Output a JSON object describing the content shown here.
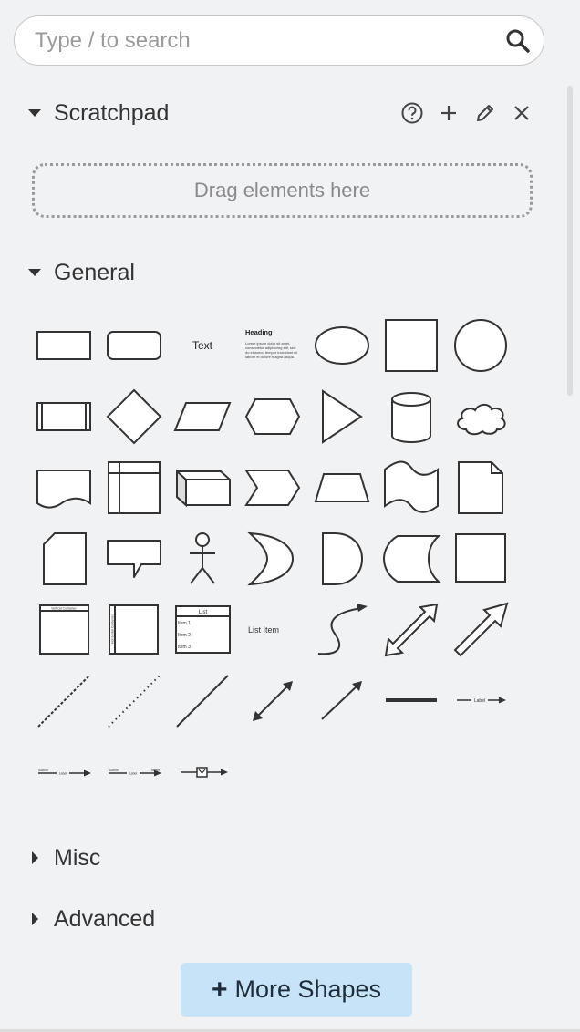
{
  "search": {
    "placeholder": "Type / to search",
    "value": ""
  },
  "scratchpad": {
    "title": "Scratchpad",
    "dropzone_text": "Drag elements here",
    "actions": [
      "help-icon",
      "add-icon",
      "edit-icon",
      "close-icon"
    ]
  },
  "general": {
    "title": "General",
    "shape_text": {
      "text": "Text",
      "heading_title": "Heading",
      "heading_body": [
        "Lorem ipsum dolor sit amet,",
        "consectetur adipisicing elit, sed",
        "do eiusmod tempor incididunt ut",
        "labore et dolore magna aliqua."
      ],
      "list_header": "List",
      "list_items": [
        "Item 1",
        "Item 2",
        "Item 3"
      ],
      "list_item": "List Item",
      "vertical_container": "Vertical Container",
      "horizontal_container": "Horizontal Container",
      "label": "Label",
      "source": "Source",
      "target": "Target"
    },
    "shapes": [
      "rectangle",
      "rounded-rectangle",
      "text",
      "textbox",
      "ellipse",
      "square",
      "circle",
      "process",
      "diamond",
      "parallelogram",
      "hexagon",
      "triangle",
      "cylinder",
      "cloud",
      "document",
      "internal-storage",
      "cube",
      "step",
      "trapezoid",
      "tape",
      "note",
      "card",
      "callout",
      "actor",
      "or",
      "and",
      "data-storage",
      "container-square",
      "vertical-container",
      "horizontal-container",
      "list",
      "list-item",
      "curve",
      "bidirectional-arrow",
      "arrow",
      "dashed-line",
      "dotted-line",
      "line",
      "bidirectional-connector",
      "directional-connector",
      "link",
      "connector-with-label",
      "connector-with-2-labels",
      "connector-with-3-labels",
      "connector-with-symbol"
    ]
  },
  "misc": {
    "title": "Misc"
  },
  "advanced": {
    "title": "Advanced"
  },
  "more_shapes": {
    "label": "More Shapes"
  },
  "colors": {
    "background": "#f1f2f4",
    "stroke": "#333333",
    "button": "#c6e3f8"
  }
}
